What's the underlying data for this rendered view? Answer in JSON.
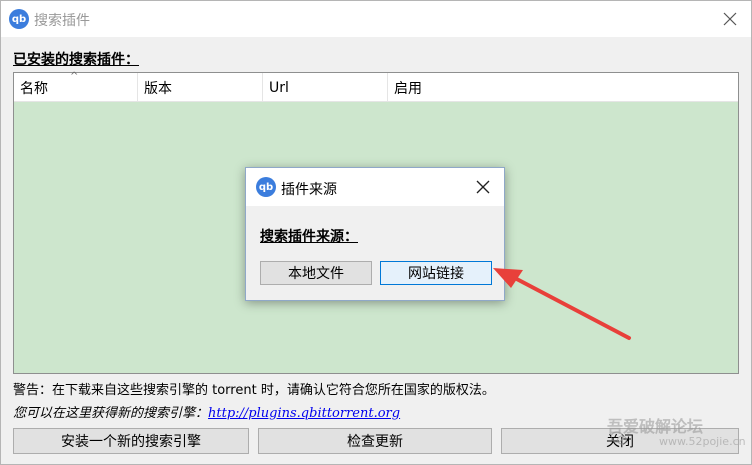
{
  "window": {
    "app_icon_text": "qb",
    "title": "搜索插件"
  },
  "main": {
    "installed_label": "已安装的搜索插件：",
    "columns": [
      "名称",
      "版本",
      "Url",
      "启用"
    ],
    "warning": "警告：在下载来自这些搜索引擎的 torrent 时，请确认它符合您所在国家的版权法。",
    "hint_prefix": "您可以在这里获得新的搜索引擎：",
    "hint_link": "http://plugins.qbittorrent.org",
    "buttons": {
      "install": "安装一个新的搜索引擎",
      "check_updates": "检查更新",
      "close": "关闭"
    }
  },
  "dialog": {
    "app_icon_text": "qb",
    "title": "插件来源",
    "label": "搜索插件来源：",
    "local_file": "本地文件",
    "web_link": "网站链接"
  },
  "annotation": {
    "arrow_color": "#e8403a"
  },
  "watermark": {
    "text": "吾爱破解论坛",
    "url": "www.52pojie.cn"
  }
}
